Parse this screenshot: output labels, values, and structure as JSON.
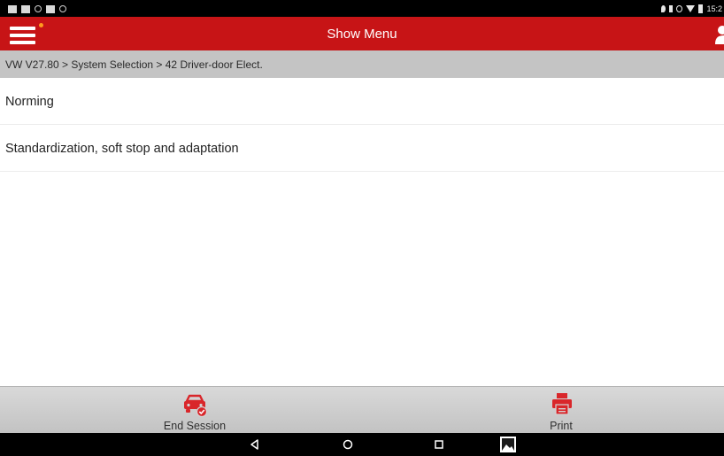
{
  "status_bar": {
    "time": "15:2"
  },
  "app_bar": {
    "title": "Show Menu",
    "menu_icon": "hamburger-menu-icon",
    "user_icon": "user-icon",
    "accent_color": "#c71416",
    "notification_dot_color": "#ff9a1f"
  },
  "breadcrumb": {
    "text": "VW V27.80 > System Selection > 42 Driver-door Elect."
  },
  "menu": {
    "items": [
      {
        "label": "Norming"
      },
      {
        "label": "Standardization, soft stop and adaptation"
      }
    ]
  },
  "toolbar": {
    "end_session_label": "End Session",
    "print_label": "Print",
    "end_session_icon": "car-check-icon",
    "print_icon": "printer-icon"
  },
  "nav_bar": {
    "back_icon": "back-triangle-icon",
    "home_icon": "home-circle-icon",
    "recent_icon": "recent-apps-square-icon",
    "gallery_icon": "gallery-image-icon"
  }
}
